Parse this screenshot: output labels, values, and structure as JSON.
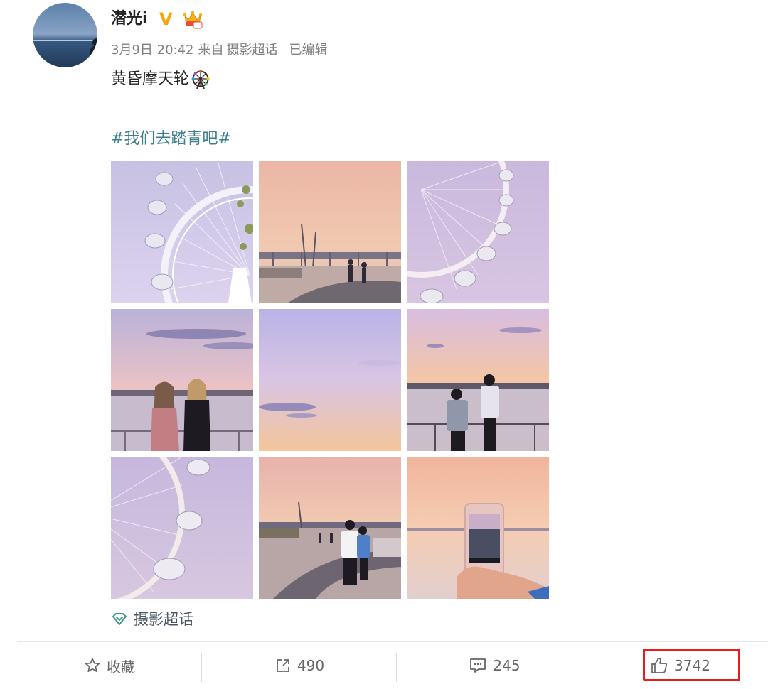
{
  "post": {
    "author": {
      "name": "潜光i",
      "verified_mark": "V",
      "avatar": "avatar-photo"
    },
    "meta": {
      "date": "3月9日 20:42",
      "source_prefix": "来自",
      "source": "摄影超话",
      "edited": "已编辑"
    },
    "text": "黄昏摩天轮",
    "text_emoji": "ferris-wheel-icon",
    "hashtag": "#我们去踏青吧#",
    "photos": [
      "ferris-wheel-closeup",
      "boardwalk-bridge",
      "ferris-wheel-arc",
      "two-women-seaside",
      "pastel-sky",
      "couple-at-railing",
      "ferris-wheel-cabins",
      "couple-walking",
      "phone-photo-sunset"
    ],
    "topic": "摄影超话"
  },
  "toolbar": {
    "favorite": {
      "label": "收藏",
      "icon": "star-icon"
    },
    "repost": {
      "count": "490",
      "icon": "share-icon"
    },
    "comment": {
      "count": "245",
      "icon": "comment-icon"
    },
    "like": {
      "count": "3742",
      "icon": "thumbs-up-icon"
    }
  },
  "colors": {
    "hashtag": "#3e7f8c",
    "badge_v": "#f5a60b",
    "highlight": "#e81c1c"
  }
}
